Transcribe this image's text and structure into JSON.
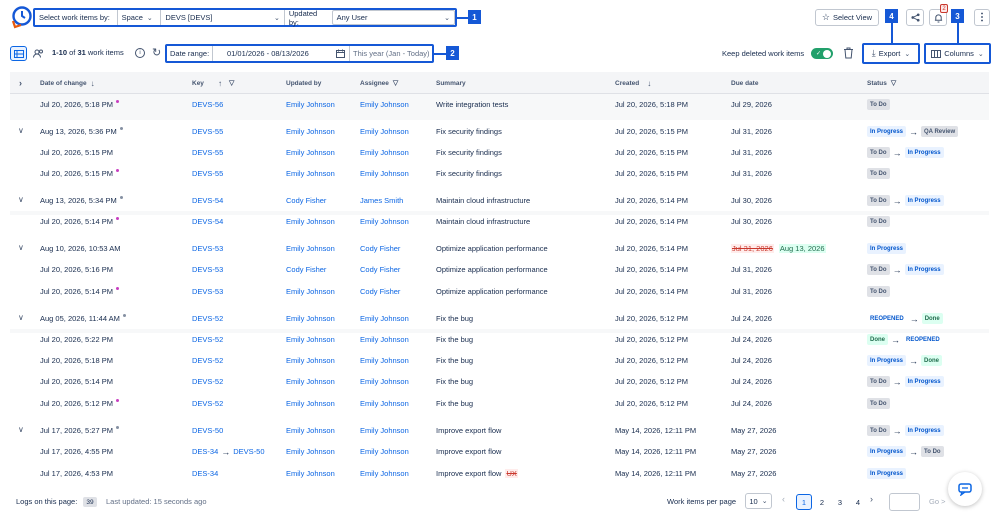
{
  "header": {
    "filter": {
      "select_label": "Select work items by:",
      "scope_value": "Space",
      "space_value": "DEVS [DEVS]",
      "updated_by_label": "Updated by:",
      "updated_by_value": "Any User"
    },
    "callouts": [
      "1",
      "2",
      "3",
      "4"
    ],
    "select_view_label": "Select View",
    "notification_count": "2"
  },
  "toolbar": {
    "count_text_a": "1-10",
    "count_text_b": " of ",
    "count_total": "31",
    "count_text_c": " work items",
    "date_range_label": "Date range:",
    "date_range_value": "01/01/2026 - 08/13/2026",
    "date_preset": "This year (Jan - Today)",
    "keep_deleted_label": "Keep deleted work items",
    "export_label": "Export",
    "columns_label": "Columns"
  },
  "table": {
    "headers": {
      "date": "Date of change",
      "key": "Key",
      "updated_by": "Updated by",
      "assignee": "Assignee",
      "summary": "Summary",
      "created": "Created",
      "due": "Due date",
      "status": "Status"
    },
    "rows": [
      {
        "date": "Jul 20, 2026, 5:18 PM",
        "key": "DEVS-56",
        "upd": "Emily Johnson",
        "asg": "Emily Johnson",
        "sum": "Write integration tests",
        "created": "Jul 20, 2026, 5:18 PM",
        "due": "Jul 29, 2026"
      },
      {
        "date": "Aug 13, 2026, 5:36 PM",
        "key": "DEVS-55",
        "upd": "Emily Johnson",
        "asg": "Emily Johnson",
        "sum": "Fix security findings",
        "created": "Jul 20, 2026, 5:15 PM",
        "due": "Jul 31, 2026"
      },
      {
        "date": "Jul 20, 2026, 5:15 PM",
        "key": "DEVS-55",
        "upd": "Emily Johnson",
        "asg": "Emily Johnson",
        "sum": "Fix security findings",
        "created": "Jul 20, 2026, 5:15 PM",
        "due": "Jul 31, 2026"
      },
      {
        "date": "Jul 20, 2026, 5:15 PM",
        "key": "DEVS-55",
        "upd": "Emily Johnson",
        "asg": "Emily Johnson",
        "sum": "Fix security findings",
        "created": "Jul 20, 2026, 5:15 PM",
        "due": "Jul 31, 2026"
      },
      {
        "date": "Aug 13, 2026, 5:34 PM",
        "key": "DEVS-54",
        "upd": "Cody Fisher",
        "asg": "James Smith",
        "sum": "Maintain cloud infrastructure",
        "created": "Jul 20, 2026, 5:14 PM",
        "due": "Jul 30, 2026"
      },
      {
        "date": "Jul 20, 2026, 5:14 PM",
        "key": "DEVS-54",
        "upd": "Emily Johnson",
        "asg": "Emily Johnson",
        "sum": "Maintain cloud infrastructure",
        "created": "Jul 20, 2026, 5:14 PM",
        "due": "Jul 30, 2026"
      },
      {
        "date": "Aug 10, 2026, 10:53 AM",
        "key": "DEVS-53",
        "upd": "Emily Johnson",
        "asg": "Cody Fisher",
        "sum": "Optimize application performance",
        "created": "Jul 20, 2026, 5:14 PM",
        "due_old": "Jul 31, 2026",
        "due": "Aug 13, 2026"
      },
      {
        "date": "Jul 20, 2026, 5:16 PM",
        "key": "DEVS-53",
        "upd": "Cody Fisher",
        "asg": "Cody Fisher",
        "sum": "Optimize application performance",
        "created": "Jul 20, 2026, 5:14 PM",
        "due": "Jul 31, 2026"
      },
      {
        "date": "Jul 20, 2026, 5:14 PM",
        "key": "DEVS-53",
        "upd": "Emily Johnson",
        "asg": "Cody Fisher",
        "sum": "Optimize application performance",
        "created": "Jul 20, 2026, 5:14 PM",
        "due": "Jul 31, 2026"
      },
      {
        "date": "Aug 05, 2026, 11:44 AM",
        "key": "DEVS-52",
        "upd": "Emily Johnson",
        "asg": "Emily Johnson",
        "sum": "Fix the bug",
        "created": "Jul 20, 2026, 5:12 PM",
        "due": "Jul 24, 2026"
      },
      {
        "date": "Jul 20, 2026, 5:22 PM",
        "key": "DEVS-52",
        "upd": "Emily Johnson",
        "asg": "Emily Johnson",
        "sum": "Fix the bug",
        "created": "Jul 20, 2026, 5:12 PM",
        "due": "Jul 24, 2026"
      },
      {
        "date": "Jul 20, 2026, 5:18 PM",
        "key": "DEVS-52",
        "upd": "Emily Johnson",
        "asg": "Emily Johnson",
        "sum": "Fix the bug",
        "created": "Jul 20, 2026, 5:12 PM",
        "due": "Jul 24, 2026"
      },
      {
        "date": "Jul 20, 2026, 5:14 PM",
        "key": "DEVS-52",
        "upd": "Emily Johnson",
        "asg": "Emily Johnson",
        "sum": "Fix the bug",
        "created": "Jul 20, 2026, 5:12 PM",
        "due": "Jul 24, 2026"
      },
      {
        "date": "Jul 20, 2026, 5:12 PM",
        "key": "DEVS-52",
        "upd": "Emily Johnson",
        "asg": "Emily Johnson",
        "sum": "Fix the bug",
        "created": "Jul 20, 2026, 5:12 PM",
        "due": "Jul 24, 2026"
      },
      {
        "date": "Jul 17, 2026, 5:27 PM",
        "key": "DEVS-50",
        "upd": "Emily Johnson",
        "asg": "Emily Johnson",
        "sum": "Improve export flow",
        "created": "May 14, 2026, 12:11 PM",
        "due": "May 27, 2026"
      },
      {
        "date": "Jul 17, 2026, 4:55 PM",
        "key": "DES-34",
        "key_new": "DEVS-50",
        "upd": "Emily Johnson",
        "asg": "Emily Johnson",
        "sum": "Improve export flow",
        "created": "May 14, 2026, 12:11 PM",
        "due": "May 27, 2026"
      },
      {
        "date": "Jul 17, 2026, 4:53 PM",
        "key": "DES-34",
        "upd": "Emily Johnson",
        "asg": "Emily Johnson",
        "sum": "Improve export flow",
        "sum_old": "UX",
        "created": "May 14, 2026, 12:11 PM",
        "due": "May 27, 2026"
      }
    ],
    "statuses": {
      "todo": "To Do",
      "inprog": "In Progress",
      "qa": "QA Review",
      "reopened": "REOPENED",
      "done": "Done"
    }
  },
  "footer": {
    "logs_label": "Logs on this page:",
    "logs_count": "39",
    "last_updated": "Last updated: 15 seconds ago",
    "per_page_label": "Work items per page",
    "per_page_value": "10",
    "pages": [
      "1",
      "2",
      "3",
      "4"
    ],
    "go_label": "Go >"
  }
}
